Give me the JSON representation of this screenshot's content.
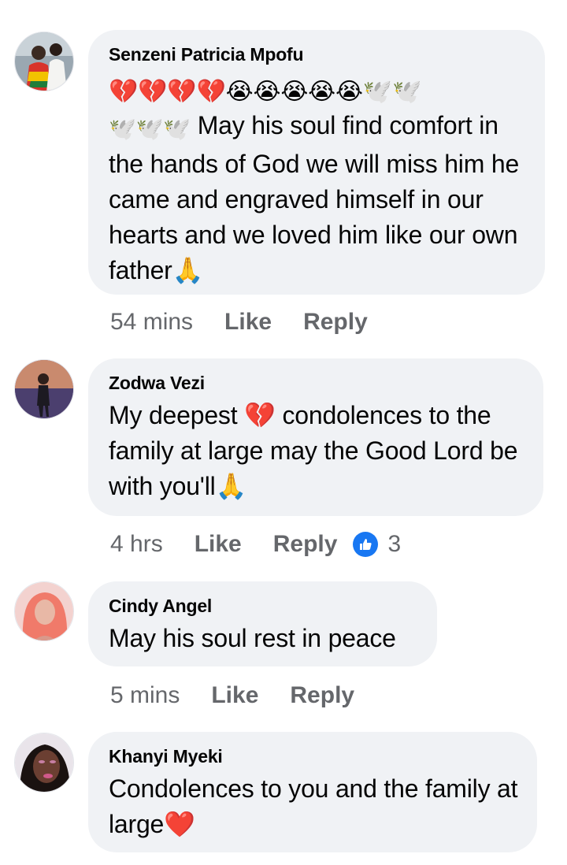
{
  "comments": [
    {
      "name": "Senzeni Patricia Mpofu",
      "emoji_line1": "💔💔💔💔😭😭😭😭😭🕊️🕊️",
      "emoji_line2_prefix": "🕊️🕊️🕊️",
      "text": "May his soul find comfort in the hands of God we will miss him he came and engraved himself in our hearts and we loved him like our own father🙏",
      "time": "54 mins",
      "like": "Like",
      "reply": "Reply"
    },
    {
      "name": "Zodwa Vezi",
      "text": "My deepest 💔 condolences to the family at large may the Good Lord be with you'll🙏",
      "time": "4 hrs",
      "like": "Like",
      "reply": "Reply",
      "reaction_icon": "like-icon",
      "reaction_count": "3"
    },
    {
      "name": "Cindy Angel",
      "text": "May his soul rest in peace",
      "time": "5 mins",
      "like": "Like",
      "reply": "Reply"
    },
    {
      "name": "Khanyi Myeki",
      "text": "Condolences to you and the family at large❤️"
    }
  ],
  "colors": {
    "bubble": "#f0f2f5",
    "meta": "#65676b",
    "like_badge": "#1877f2"
  }
}
